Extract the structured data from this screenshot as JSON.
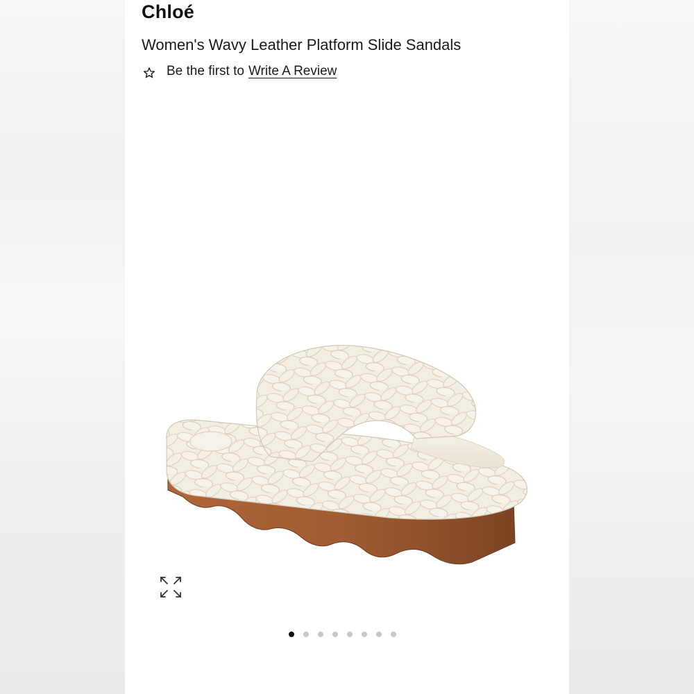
{
  "product": {
    "brand": "Chloé",
    "title": "Women's Wavy Leather Platform Slide Sandals",
    "review_prefix": "Be the first to",
    "review_link": "Write A Review",
    "image_alt": "Chloé wavy braided leather platform slide sandal"
  },
  "icons": {
    "star": "star-outline-icon",
    "zoom": "expand-arrows-icon"
  },
  "carousel": {
    "count": 8,
    "active_index": 0
  },
  "colors": {
    "leather": "#f1ece0",
    "sole": "#9e5a31"
  }
}
